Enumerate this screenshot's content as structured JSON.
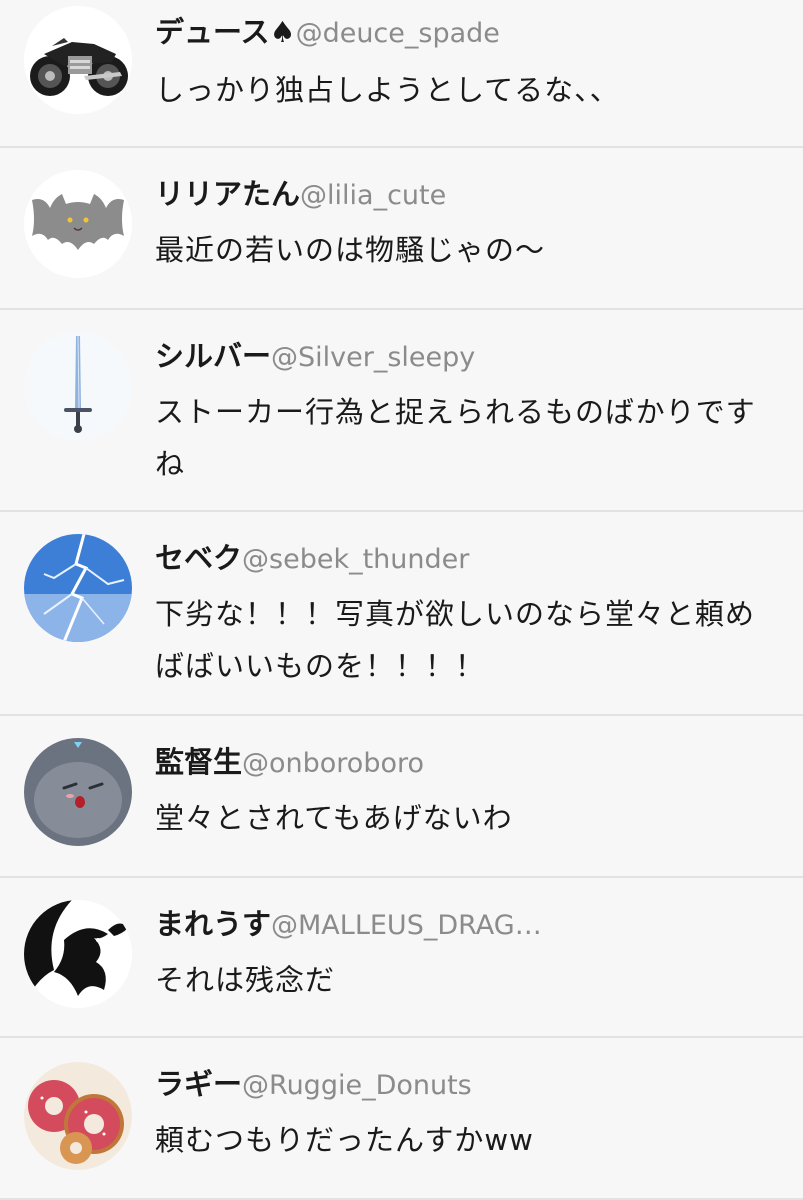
{
  "replies": [
    {
      "name": "デュース♠",
      "handle": "@deuce_spade",
      "text": "しっかり独占しようとしてるな、、",
      "avatar_icon": "motorcycle-icon"
    },
    {
      "name": "リリアたん",
      "handle": "@lilia_cute",
      "text": "最近の若いのは物騒じゃの〜",
      "avatar_icon": "bat-icon"
    },
    {
      "name": "シルバー",
      "handle": "@Silver_sleepy",
      "text": "ストーカー行為と捉えられるものばかりですね",
      "avatar_icon": "sword-icon"
    },
    {
      "name": "セベク",
      "handle": "@sebek_thunder",
      "text": "下劣な！！！写真が欲しいのなら堂々と頼めばばいいものを！！！！",
      "avatar_icon": "lightning-icon"
    },
    {
      "name": "監督生",
      "handle": "@onboroboro",
      "text": "堂々とされてもあげないわ",
      "avatar_icon": "ghost-cat-icon"
    },
    {
      "name": "まれうす",
      "handle": "@MALLEUS_DRAG…",
      "text": "それは残念だ",
      "avatar_icon": "dragon-icon"
    },
    {
      "name": "ラギー",
      "handle": "@Ruggie_Donuts",
      "text": "頼むつもりだったんすかww",
      "avatar_icon": "donuts-icon"
    }
  ]
}
